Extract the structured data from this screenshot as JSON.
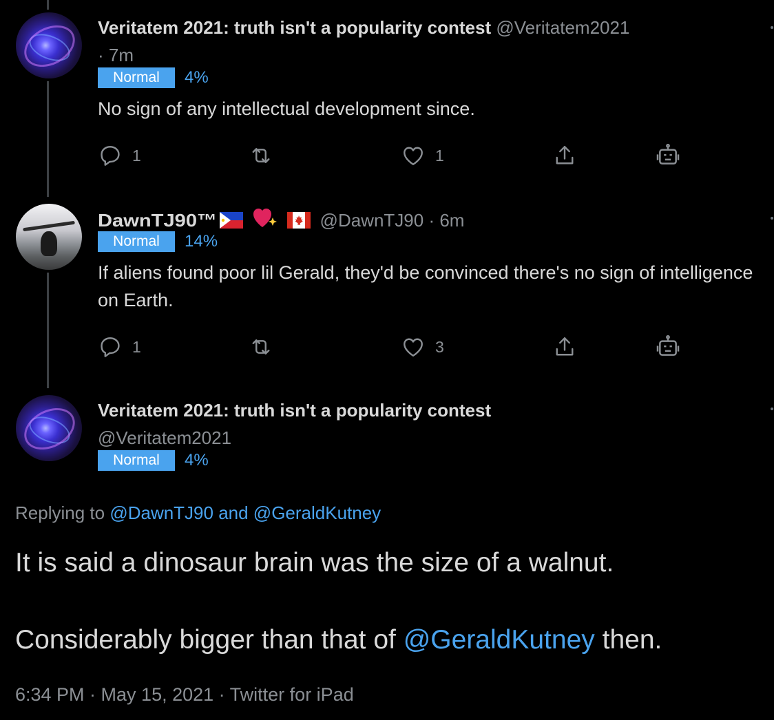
{
  "tweets": [
    {
      "name": "Veritatem 2021: truth isn't a popularity contest",
      "handle": "@Veritatem2021",
      "time": "· 7m",
      "badge": "Normal",
      "score": "4%",
      "text": "No sign of any intellectual development since.",
      "replies": "1",
      "likes": "1"
    },
    {
      "name": "DawnTJ90™",
      "handle": "@DawnTJ90",
      "time": "· 6m",
      "badge": "Normal",
      "score": "14%",
      "text": "If aliens found poor lil Gerald, they'd be convinced there's no sign of intelligence on Earth.",
      "replies": "1",
      "likes": "3"
    }
  ],
  "main_tweet": {
    "name": "Veritatem 2021: truth isn't a popularity contest",
    "handle": "@Veritatem2021",
    "badge": "Normal",
    "score": "4%",
    "replying_prefix": "Replying to",
    "replying_to": "@DawnTJ90 and @GeraldKutney",
    "line1": "It is said a dinosaur brain was the size of a walnut.",
    "line2_prefix": "Considerably bigger than that of",
    "line2_mention": "@GeraldKutney",
    "line2_suffix": "then.",
    "timestamp": "6:34 PM · May 15, 2021 · Twitter for iPad"
  },
  "icons": [
    "reply-icon",
    "retweet-icon",
    "like-icon",
    "share-icon",
    "bot-icon",
    "flag-philippines-icon",
    "sparkling-heart-icon",
    "flag-canada-icon"
  ],
  "colors": {
    "background": "#000000",
    "text": "#d9d9d9",
    "muted": "#8b8f94",
    "accent": "#4aa3ee",
    "thread_line": "#3d4145"
  }
}
